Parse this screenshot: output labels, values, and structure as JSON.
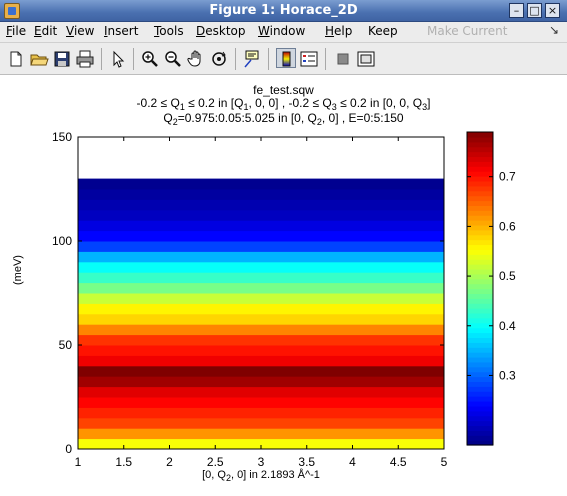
{
  "window": {
    "title": "Figure 1: Horace_2D"
  },
  "menubar": {
    "items": [
      {
        "label": "File",
        "underline": "F",
        "rest": "ile",
        "enabled": true
      },
      {
        "label": "Edit",
        "underline": "E",
        "rest": "dit",
        "enabled": true
      },
      {
        "label": "View",
        "underline": "V",
        "rest": "iew",
        "enabled": true
      },
      {
        "label": "Insert",
        "underline": "I",
        "rest": "nsert",
        "enabled": true
      },
      {
        "label": "Tools",
        "underline": "T",
        "rest": "ools",
        "enabled": true
      },
      {
        "label": "Desktop",
        "underline": "D",
        "rest": "esktop",
        "enabled": true
      },
      {
        "label": "Window",
        "underline": "W",
        "rest": "indow",
        "enabled": true
      },
      {
        "label": "Help",
        "underline": "H",
        "rest": "elp",
        "enabled": true
      },
      {
        "label": "Keep",
        "underline": "",
        "rest": "Keep",
        "enabled": true
      },
      {
        "label": "Make Current",
        "underline": "",
        "rest": "Make Current",
        "enabled": false
      }
    ],
    "dock_arrow": "↘"
  },
  "toolbar": {
    "icons": [
      "new-figure-icon",
      "open-file-icon",
      "save-icon",
      "print-icon",
      "pointer-icon",
      "zoom-in-icon",
      "zoom-out-icon",
      "pan-icon",
      "rotate-3d-icon",
      "data-cursor-icon",
      "colorbar-icon",
      "legend-icon",
      "hide-plot-tools-icon",
      "show-plot-tools-icon"
    ],
    "active": [
      "colorbar-icon"
    ]
  },
  "figure": {
    "title_line1": "fe_test.sqw",
    "title_line2_parts": [
      "-0.2 ≤ Q",
      "1",
      " ≤ 0.2 in [Q",
      "1",
      ", 0, 0] , -0.2 ≤ Q",
      "3",
      " ≤ 0.2 in [0, 0, Q",
      "3",
      "]"
    ],
    "title_line3_parts": [
      "Q",
      "2",
      "=0.975:0.05:5.025 in [0, Q",
      "2",
      ", 0] , E=0:5:150"
    ]
  },
  "chart_data": {
    "type": "heatmap",
    "x_range": [
      1,
      5
    ],
    "y_range": [
      0,
      150
    ],
    "xlim": [
      1,
      5
    ],
    "ylim": [
      0,
      150
    ],
    "xticks": [
      "1",
      "1.5",
      "2",
      "2.5",
      "3",
      "3.5",
      "4",
      "4.5",
      "5"
    ],
    "yticks": [
      "0",
      "50",
      "100",
      "150"
    ],
    "ylabel": "(meV)",
    "xlabel_parts": [
      "[0, Q",
      "2",
      ", 0] in 2.1893 Å^-1"
    ],
    "colormap": "jet",
    "clim": [
      0.16,
      0.79
    ],
    "colorbar_ticks": [
      "0.3",
      "0.4",
      "0.5",
      "0.6",
      "0.7"
    ],
    "colorbar_tick_values": [
      0.3,
      0.4,
      0.5,
      0.6,
      0.7
    ],
    "bands": {
      "energy_bins_meV": [
        0,
        5,
        10,
        15,
        20,
        25,
        30,
        35,
        40,
        45,
        50,
        55,
        60,
        65,
        70,
        75,
        80,
        85,
        90,
        95,
        100,
        105,
        110,
        115,
        120,
        125,
        130
      ],
      "bin_width_meV": 5,
      "values": [
        0.55,
        0.62,
        0.67,
        0.69,
        0.71,
        0.73,
        0.77,
        0.79,
        0.72,
        0.7,
        0.68,
        0.63,
        0.58,
        0.56,
        0.52,
        0.47,
        0.43,
        0.4,
        0.35,
        0.28,
        0.24,
        0.22,
        0.2,
        0.19,
        0.18,
        0.17
      ]
    },
    "empty_above_meV": 130
  }
}
